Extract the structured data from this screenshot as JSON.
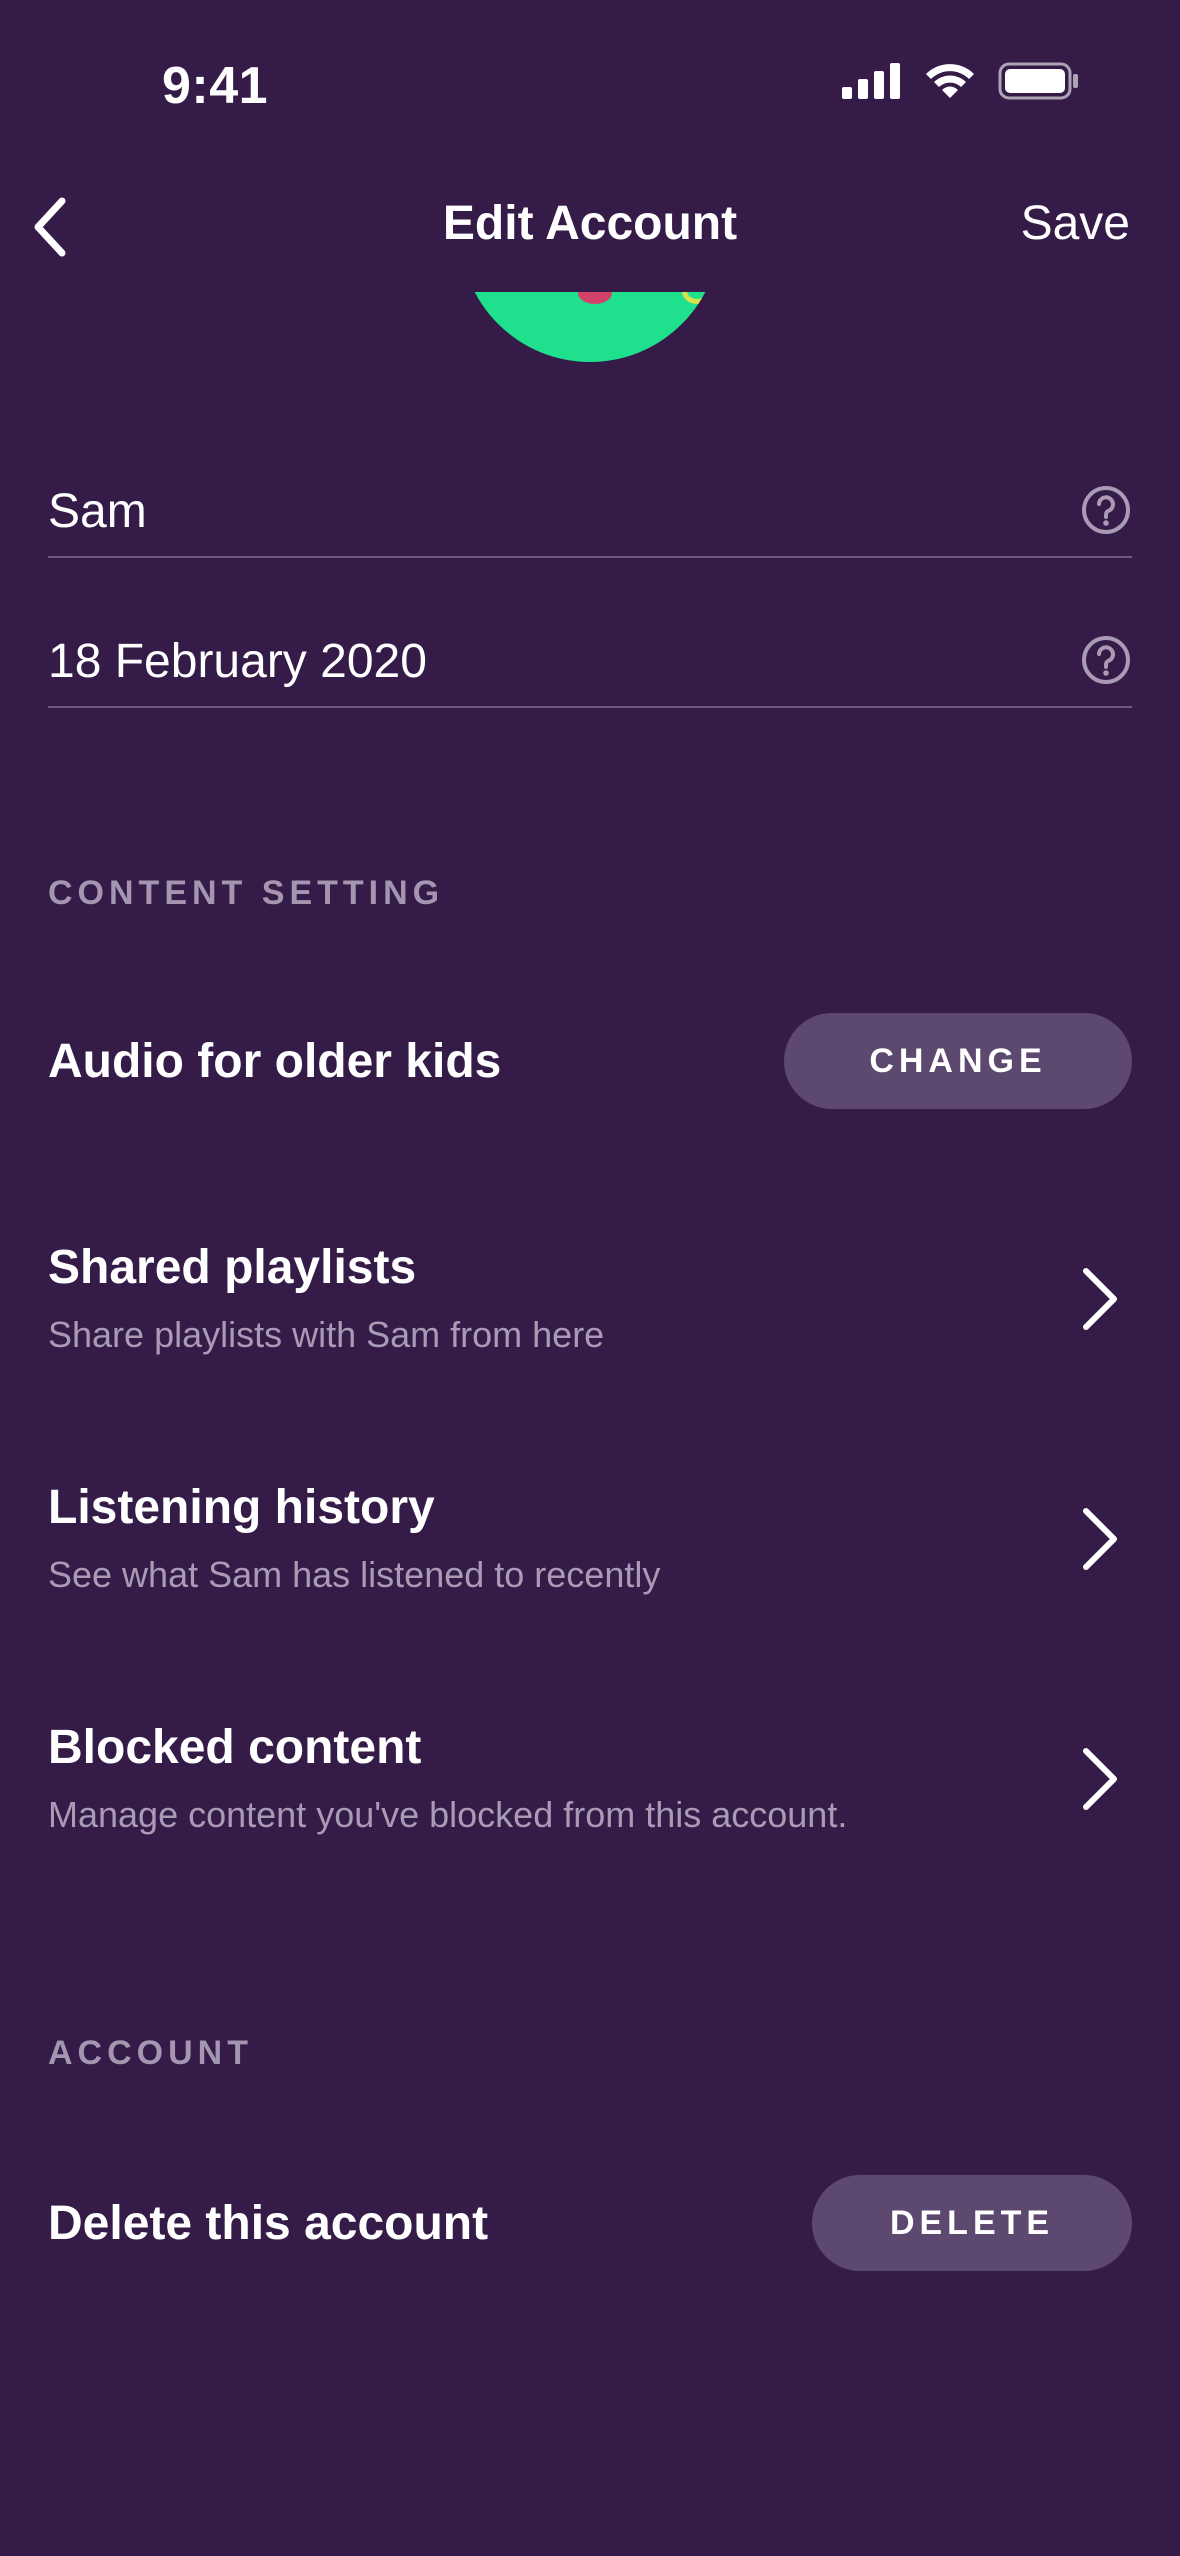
{
  "status_bar": {
    "time": "9:41"
  },
  "header": {
    "title": "Edit Account",
    "save_label": "Save"
  },
  "fields": {
    "name_value": "Sam",
    "birthday_value": "18 February 2020"
  },
  "content_setting": {
    "section_label": "CONTENT SETTING",
    "level_label": "Audio for older kids",
    "change_label": "CHANGE"
  },
  "rows": [
    {
      "title": "Shared playlists",
      "subtitle": "Share playlists with Sam from here"
    },
    {
      "title": "Listening history",
      "subtitle": "See what Sam has listened to recently"
    },
    {
      "title": "Blocked content",
      "subtitle": "Manage content you've blocked from this account."
    }
  ],
  "account": {
    "section_label": "ACCOUNT",
    "delete_row_label": "Delete this account",
    "delete_button_label": "DELETE"
  },
  "colors": {
    "background": "#351b48",
    "avatar": "#1ee08d",
    "pill_button": "#5d4870",
    "secondary_text": "#a99bb5"
  }
}
